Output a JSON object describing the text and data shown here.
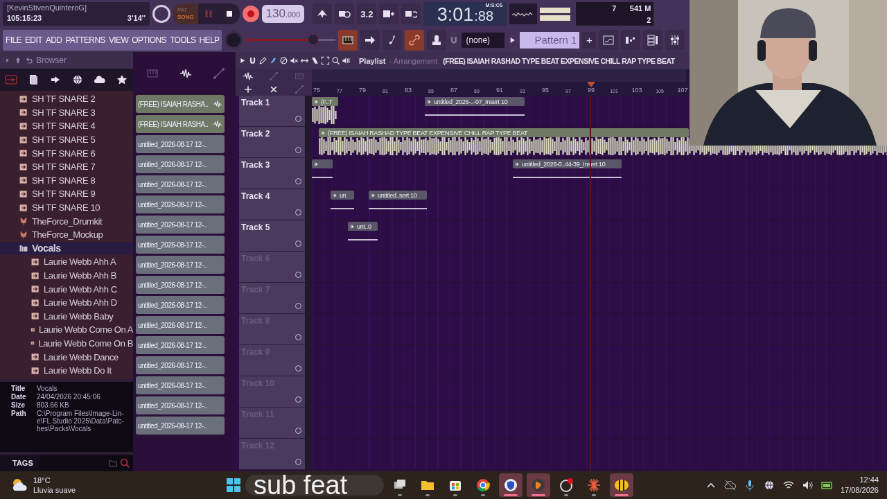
{
  "header": {
    "user": "[KevinStivenQuinteroG]",
    "time": "105:15:23",
    "duration": "3'14''",
    "modes": [
      {
        "label": "PAT",
        "selected": false
      },
      {
        "label": "SONG",
        "selected": true
      }
    ],
    "tempo": "130",
    "tempo_decimals": ".000",
    "snap_label": "3.2",
    "clock": "3:01",
    "clock_cs": ":88",
    "clock_unit": "M:S:CS",
    "cpu": "7",
    "memory": "541 M",
    "polyphony": "2"
  },
  "menu": [
    "FILE",
    "EDIT",
    "ADD",
    "PATTERNS",
    "VIEW",
    "OPTIONS",
    "TOOLS",
    "HELP"
  ],
  "master_volume": {
    "level": 0.75
  },
  "snap": "(none)",
  "pattern": "Pattern 1",
  "pattern_add": "+",
  "browser": {
    "title": "Browser",
    "tree": [
      {
        "children": [
          {
            "kind": "sample",
            "label": "SH TF SNARE 2"
          },
          {
            "kind": "sample",
            "label": "SH TF SNARE 3"
          },
          {
            "kind": "sample",
            "label": "SH TF SNARE 4"
          },
          {
            "kind": "sample",
            "label": "SH TF SNARE 5"
          },
          {
            "kind": "sample",
            "label": "SH TF SNARE 6"
          },
          {
            "kind": "sample",
            "label": "SH TF SNARE 7"
          },
          {
            "kind": "sample",
            "label": "SH TF SNARE 8"
          },
          {
            "kind": "sample",
            "label": "SH TF SNARE 9"
          },
          {
            "kind": "sample",
            "label": "SH TF SNARE 10"
          },
          {
            "kind": "pack",
            "label": "TheForce_Drumkit"
          },
          {
            "kind": "pack",
            "label": "TheForce_Mockup"
          }
        ]
      },
      {
        "kind": "folder",
        "label": "Vocals",
        "selected": true,
        "children": [
          {
            "kind": "sample",
            "label": "Laurie Webb Ahh A"
          },
          {
            "kind": "sample",
            "label": "Laurie Webb Ahh B"
          },
          {
            "kind": "sample",
            "label": "Laurie Webb Ahh C"
          },
          {
            "kind": "sample",
            "label": "Laurie Webb Ahh D"
          },
          {
            "kind": "sample",
            "label": "Laurie Webb Baby"
          },
          {
            "kind": "sample",
            "label": "Laurie Webb Come On A"
          },
          {
            "kind": "sample",
            "label": "Laurie Webb Come On B"
          },
          {
            "kind": "sample",
            "label": "Laurie Webb Dance"
          },
          {
            "kind": "sample",
            "label": "Laurie Webb Do It"
          }
        ]
      }
    ],
    "info": [
      {
        "key": "Title",
        "value": [
          "Vocals"
        ]
      },
      {
        "key": "Date",
        "value": [
          "24/04/2026 20:45:06"
        ]
      },
      {
        "key": "Size",
        "value": [
          "803.66 KB"
        ]
      },
      {
        "key": "Path",
        "value": [
          "C:\\Program Files\\Image-Lin-",
          "e\\FL Studio 2025\\Data\\Patc-",
          "hes\\Packs\\Vocals"
        ]
      }
    ],
    "tags": "TAGS"
  },
  "clip_list": [
    {
      "label": "(FREE) ISAIAH RASHA..",
      "color": "#6e7864"
    },
    {
      "label": "(FREE) ISAIAH RASHA..",
      "color": "#6e7864"
    },
    {
      "label": "untitled_2026-08-17 12-..",
      "color": "#6b6f7c"
    },
    {
      "label": "untitled_2026-08-17 12-..",
      "color": "#6b6f7c"
    },
    {
      "label": "untitled_2026-08-17 12-..",
      "color": "#6b6f7c"
    },
    {
      "label": "untitled_2026-08-17 12-..",
      "color": "#6b6f7c"
    },
    {
      "label": "untitled_2026-08-17 12-..",
      "color": "#6b6f7c"
    },
    {
      "label": "untitled_2026-08-17 12-..",
      "color": "#6b6f7c"
    },
    {
      "label": "untitled_2026-08-17 12-..",
      "color": "#6b6f7c"
    },
    {
      "label": "untitled_2026-08-17 12-..",
      "color": "#6b6f7c"
    },
    {
      "label": "untitled_2026-08-17 12-..",
      "color": "#6b6f7c"
    },
    {
      "label": "untitled_2026-08-17 12-..",
      "color": "#6b6f7c"
    },
    {
      "label": "untitled_2026-08-17 12-..",
      "color": "#6b6f7c"
    },
    {
      "label": "untitled_2026-08-17 12-..",
      "color": "#6b6f7c"
    },
    {
      "label": "untitled_2026-08-17 12-..",
      "color": "#6b6f7c"
    },
    {
      "label": "untitled_2026-08-17 12-..",
      "color": "#6b6f7c"
    },
    {
      "label": "untitled_2026-08-17 12-..",
      "color": "#6b6f7c"
    }
  ],
  "playlist": {
    "title": "Playlist",
    "subtitle": "- Arrangement",
    "song": "(FREE) ISAIAH RASHAD TYPE BEAT EXPENSIVE  CHILL RAP TYPE BEAT",
    "ruler": [
      "75",
      "77",
      "79",
      "81",
      "83",
      "85",
      "87",
      "89",
      "91",
      "93",
      "95",
      "97",
      "99",
      "101",
      "103",
      "105",
      "107"
    ],
    "tracks": [
      {
        "name": "Track 1",
        "clips": [
          {
            "kind": "full",
            "label": "(F..T"
          },
          {
            "kind": "thin",
            "label": "untitled_2026-..-07_Insert 10"
          }
        ]
      },
      {
        "name": "Track 2",
        "clips": [
          {
            "kind": "full",
            "label": "(FREE) ISAIAH RASHAD TYPE BEAT EXPENSIVE  CHILL RAP TYPE BEAT"
          }
        ]
      },
      {
        "name": "Track 3",
        "clips": [
          {
            "kind": "thin"
          },
          {
            "kind": "thin",
            "label": "untitled_2026-0..44-39_Insert 10"
          }
        ]
      },
      {
        "name": "Track 4",
        "clips": [
          {
            "kind": "thin",
            "label": "un"
          },
          {
            "kind": "thin",
            "label": "untitled..sert 10"
          }
        ]
      },
      {
        "name": "Track 5",
        "clips": [
          {
            "kind": "thin",
            "label": "unt..0"
          }
        ]
      },
      {
        "name": "Track 6"
      },
      {
        "name": "Track 7"
      },
      {
        "name": "Track 8"
      },
      {
        "name": "Track 9"
      },
      {
        "name": "Track 10"
      },
      {
        "name": "Track 11"
      },
      {
        "name": "Track 12"
      }
    ]
  },
  "webcam": {
    "kind": "picture"
  },
  "taskbar": {
    "weather_temp": "18°C",
    "weather_text": "Lluvia suave",
    "caption": "sub feat",
    "apps": [
      {
        "kind": "taskview",
        "active": false
      },
      {
        "kind": "explorer",
        "active": false
      },
      {
        "kind": "store",
        "active": false
      },
      {
        "kind": "chrome",
        "active": false
      },
      {
        "kind": "shield",
        "active": true
      },
      {
        "kind": "fl",
        "active": true
      },
      {
        "kind": "obs",
        "active": false
      },
      {
        "kind": "burst",
        "active": false
      },
      {
        "kind": "bee",
        "active": true
      }
    ],
    "time": "12:44",
    "date": "17/08/2026"
  }
}
